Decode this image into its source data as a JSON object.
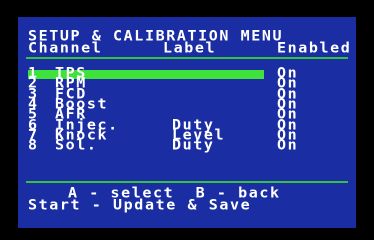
{
  "menu": {
    "title": "SETUP & CALIBRATION MENU",
    "headers": {
      "channel": "Channel",
      "label": "Label",
      "enabled": "Enabled"
    }
  },
  "rows": [
    {
      "num": "1",
      "channel": "TPS",
      "label": "",
      "enabled": "On",
      "selected": true
    },
    {
      "num": "2",
      "channel": "RPM",
      "label": "",
      "enabled": "On",
      "selected": false
    },
    {
      "num": "3",
      "channel": "FCD",
      "label": "",
      "enabled": "On",
      "selected": false
    },
    {
      "num": "4",
      "channel": "Boost",
      "label": "",
      "enabled": "On",
      "selected": false
    },
    {
      "num": "5",
      "channel": "AFR",
      "label": "",
      "enabled": "On",
      "selected": false
    },
    {
      "num": "6",
      "channel": "Injec.",
      "label": "Duty",
      "enabled": "On",
      "selected": false
    },
    {
      "num": "7",
      "channel": "Knock",
      "label": "Level",
      "enabled": "On",
      "selected": false
    },
    {
      "num": "8",
      "channel": "Sol.",
      "label": "Duty",
      "enabled": "On",
      "selected": false
    }
  ],
  "footer": {
    "line1": "A - select  B - back",
    "line2": "Start - Update & Save"
  },
  "colors": {
    "screen_bg": "#1a2da2",
    "accent_green": "#35c23f",
    "highlight_green": "#3ee23a",
    "text": "#ffffff"
  }
}
